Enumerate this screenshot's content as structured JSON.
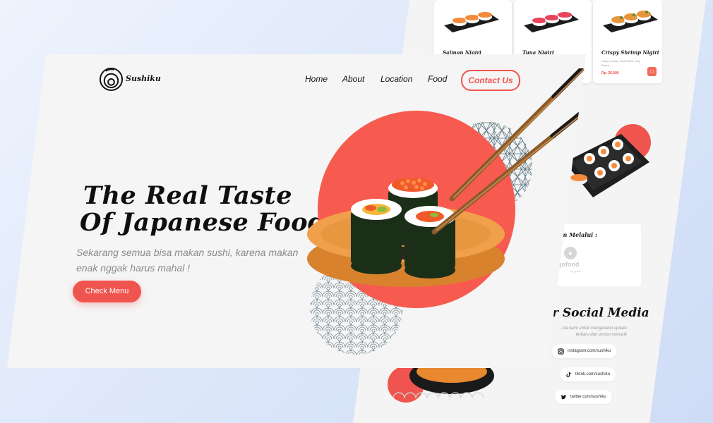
{
  "brand": "Sushiku",
  "nav": {
    "items": [
      "Home",
      "About",
      "Location",
      "Food"
    ],
    "contact_label": "Contact Us"
  },
  "hero": {
    "title_line1": "The Real Taste",
    "title_line2": "Of Japanese Food",
    "subtitle": "Sekarang semua bisa makan sushi, karena makan enak nggak harus mahal !",
    "cta_label": "Check Menu"
  },
  "menu_cards": [
    {
      "name": "Salmon Nigiri",
      "description": "",
      "price": ""
    },
    {
      "name": "Tuna Nigiri",
      "description": "",
      "price": ""
    },
    {
      "name": "Crispy Shrimp Nigiri",
      "description": "Crispy shrimp, Sushi Rice, Soy Sauce",
      "price": "Rp. 26.000"
    }
  ],
  "order": {
    "title": "...an Melalui :",
    "gofood_text": "gofood",
    "gofood_sub": "by gojek"
  },
  "social": {
    "title": "r Social Media",
    "description": "...da kami untuk mengetahui update terbaru dan promo menarik",
    "links": [
      {
        "icon": "instagram-icon",
        "label": "instagram.com/sushiku"
      },
      {
        "icon": "tiktok-icon",
        "label": "tiktok.com/sushiku"
      },
      {
        "icon": "twitter-icon",
        "label": "twitter.com/sushiku"
      }
    ]
  },
  "colors": {
    "accent": "#f0544f",
    "background": "#dde7f8",
    "panel": "#f5f5f5",
    "text": "#111111"
  }
}
